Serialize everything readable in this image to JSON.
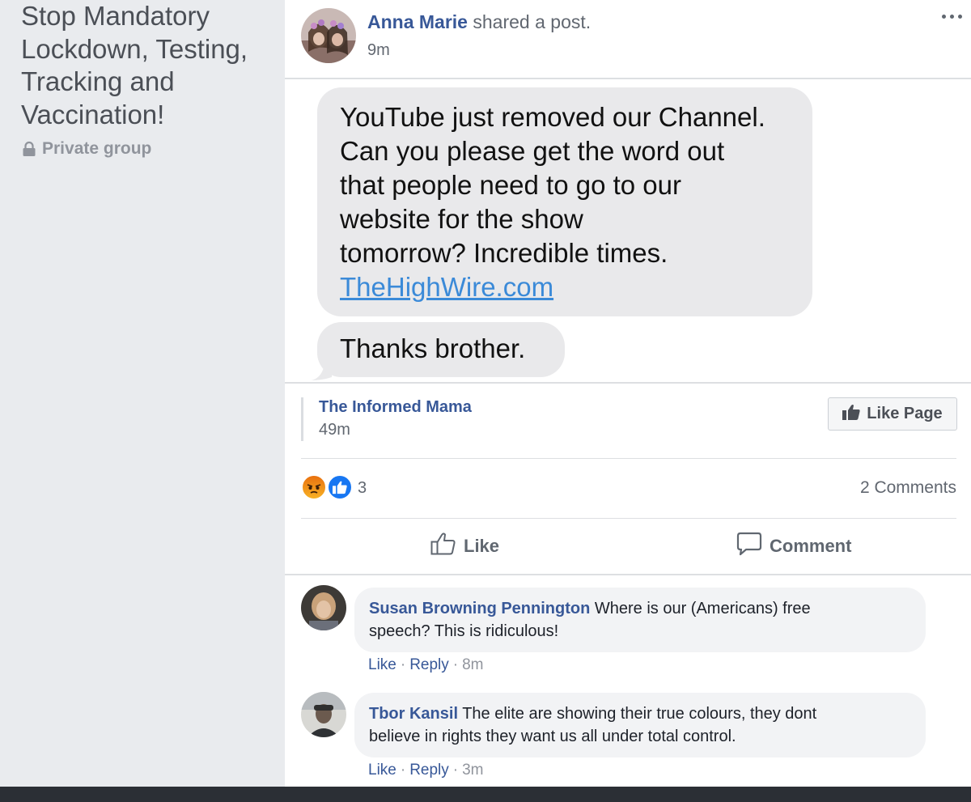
{
  "group": {
    "title_lines": [
      "Stop Mandatory",
      "Lockdown, Testing,",
      "Tracking and",
      "Vaccination!"
    ],
    "privacy_label": "Private group",
    "privacy_icon": "lock-icon"
  },
  "post": {
    "author": "Anna Marie",
    "action_text": " shared a post.",
    "time": "9m",
    "menu_icon": "more-options-icon",
    "shared_image": {
      "message_lines": [
        "YouTube just removed our Channel.",
        "Can you please get the word out",
        "that people need to go to our",
        "website for the show",
        "tomorrow?  Incredible times."
      ],
      "link_text": "TheHighWire.com",
      "link_color": "#3b8ad8",
      "reply": "Thanks brother.",
      "bubble_color": "#e9e9eb"
    },
    "shared_from": {
      "page_name": "The Informed Mama",
      "time": "49m",
      "like_page_label": "Like Page"
    },
    "reactions": {
      "types": [
        "angry",
        "like"
      ],
      "count": "3"
    },
    "comments_count_label": "2 Comments",
    "actions": {
      "like_label": "Like",
      "comment_label": "Comment"
    }
  },
  "comments": [
    {
      "author": "Susan Browning Pennington",
      "text_line1": " Where is our (Americans) free",
      "text_line2": "speech? This is ridiculous!",
      "like_label": "Like",
      "reply_label": "Reply",
      "time": "8m"
    },
    {
      "author": "Tbor Kansil",
      "text_line1": " The elite are showing their true colours, they dont",
      "text_line2": "believe in rights they want us all under total control.",
      "like_label": "Like",
      "reply_label": "Reply",
      "time": "3m"
    }
  ],
  "colors": {
    "link_blue": "#385898",
    "background": "#e9ebee",
    "meta_grey": "#616770"
  }
}
